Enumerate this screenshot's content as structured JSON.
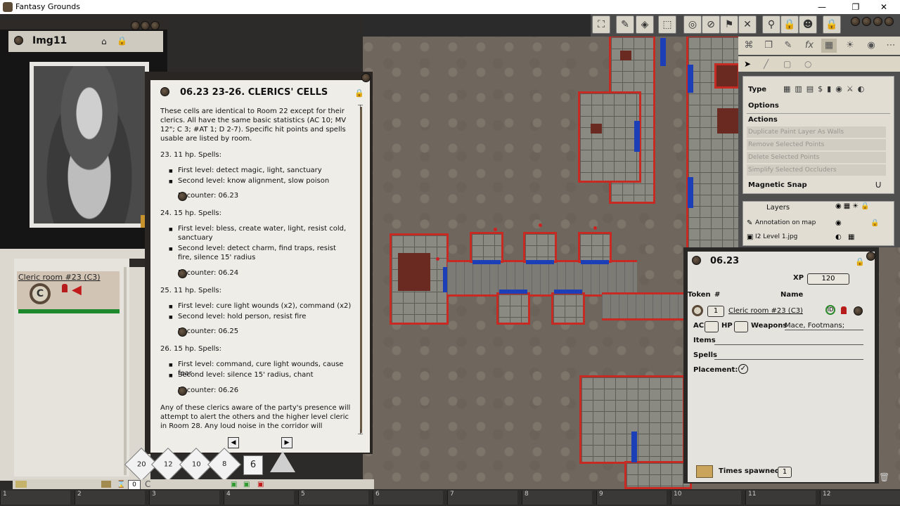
{
  "app": {
    "title": "Fantasy Grounds"
  },
  "window_controls": {
    "minimize": "—",
    "maximize": "❐",
    "close": "✕"
  },
  "image_window": {
    "title": "Img11",
    "lock_icon": "lock-icon"
  },
  "story": {
    "title": "06.23 23-26. CLERICS' CELLS",
    "intro": "These cells are identical to Room 22 except for their clerics. All have the same basic statistics (AC 10; MV 12\"; C 3; #AT 1; D 2-7). Specific hit points and spells usable are listed by room.",
    "sections": [
      {
        "heading": "23. 11 hp. Spells:",
        "bullets": [
          "First level: detect magic, light, sanctuary",
          "Second level: know alignment, slow poison"
        ],
        "link": "Encounter: 06.23"
      },
      {
        "heading": "24. 15 hp. Spells:",
        "bullets": [
          "First level: bless, create water, light, resist cold, sanctuary",
          "Second level: detect charm, find traps, resist fire, silence 15' radius"
        ],
        "link": "Encounter: 06.24"
      },
      {
        "heading": "25. 11 hp. Spells:",
        "bullets": [
          "First level: cure light wounds (x2), command (x2)",
          "Second level: hold person, resist fire"
        ],
        "link": "Encounter: 06.25"
      },
      {
        "heading": "26. 15 hp. Spells:",
        "bullets": [
          "First level: command, cure light wounds, cause fear",
          "Second level: silence 15' radius, chant"
        ],
        "link": "Encounter: 06.26"
      }
    ],
    "outro": "Any of these clerics aware of the party's presence will attempt to alert the others and the higher level cleric in Room 28. Any loud noise in the corridor will immediately"
  },
  "dice": [
    "20",
    "12",
    "10",
    "8",
    "6"
  ],
  "combat_tracker": {
    "entry": "Cleric room #23 (C3)"
  },
  "right_panel": {
    "type_label": "Type",
    "options_label": "Options",
    "actions_label": "Actions",
    "actions": [
      "Duplicate Paint Layer As Walls",
      "Remove Selected Points",
      "Delete Selected Points",
      "Simplify Selected Occluders"
    ],
    "magnetic_snap": "Magnetic Snap",
    "layers_title": "Layers",
    "layers": [
      "Annotation on map",
      "I2 Level 1.jpg"
    ]
  },
  "encounter": {
    "title": "06.23",
    "xp_label": "XP",
    "xp": "120",
    "token_header": "Token",
    "count_header": "#",
    "name_header": "Name",
    "count": "1",
    "name": "Cleric room #23 (C3)",
    "ac_label": "AC",
    "hp_label": "HP",
    "weapons_label": "Weapons",
    "weapons": "Mace, Footmans;",
    "items_label": "Items",
    "spells_label": "Spells",
    "placement_label": "Placement:",
    "spawned_label": "Times spawned",
    "spawned": "1"
  },
  "hotkeys": [
    "1",
    "2",
    "3",
    "4",
    "5",
    "6",
    "7",
    "8",
    "9",
    "10",
    "11",
    "12"
  ],
  "chat_bar": {
    "modifier": "0"
  },
  "colors": {
    "wall_red": "#c62a22",
    "door_blue": "#1c3fb8",
    "paper": "#efede8",
    "panel": "#e1ddd3"
  }
}
